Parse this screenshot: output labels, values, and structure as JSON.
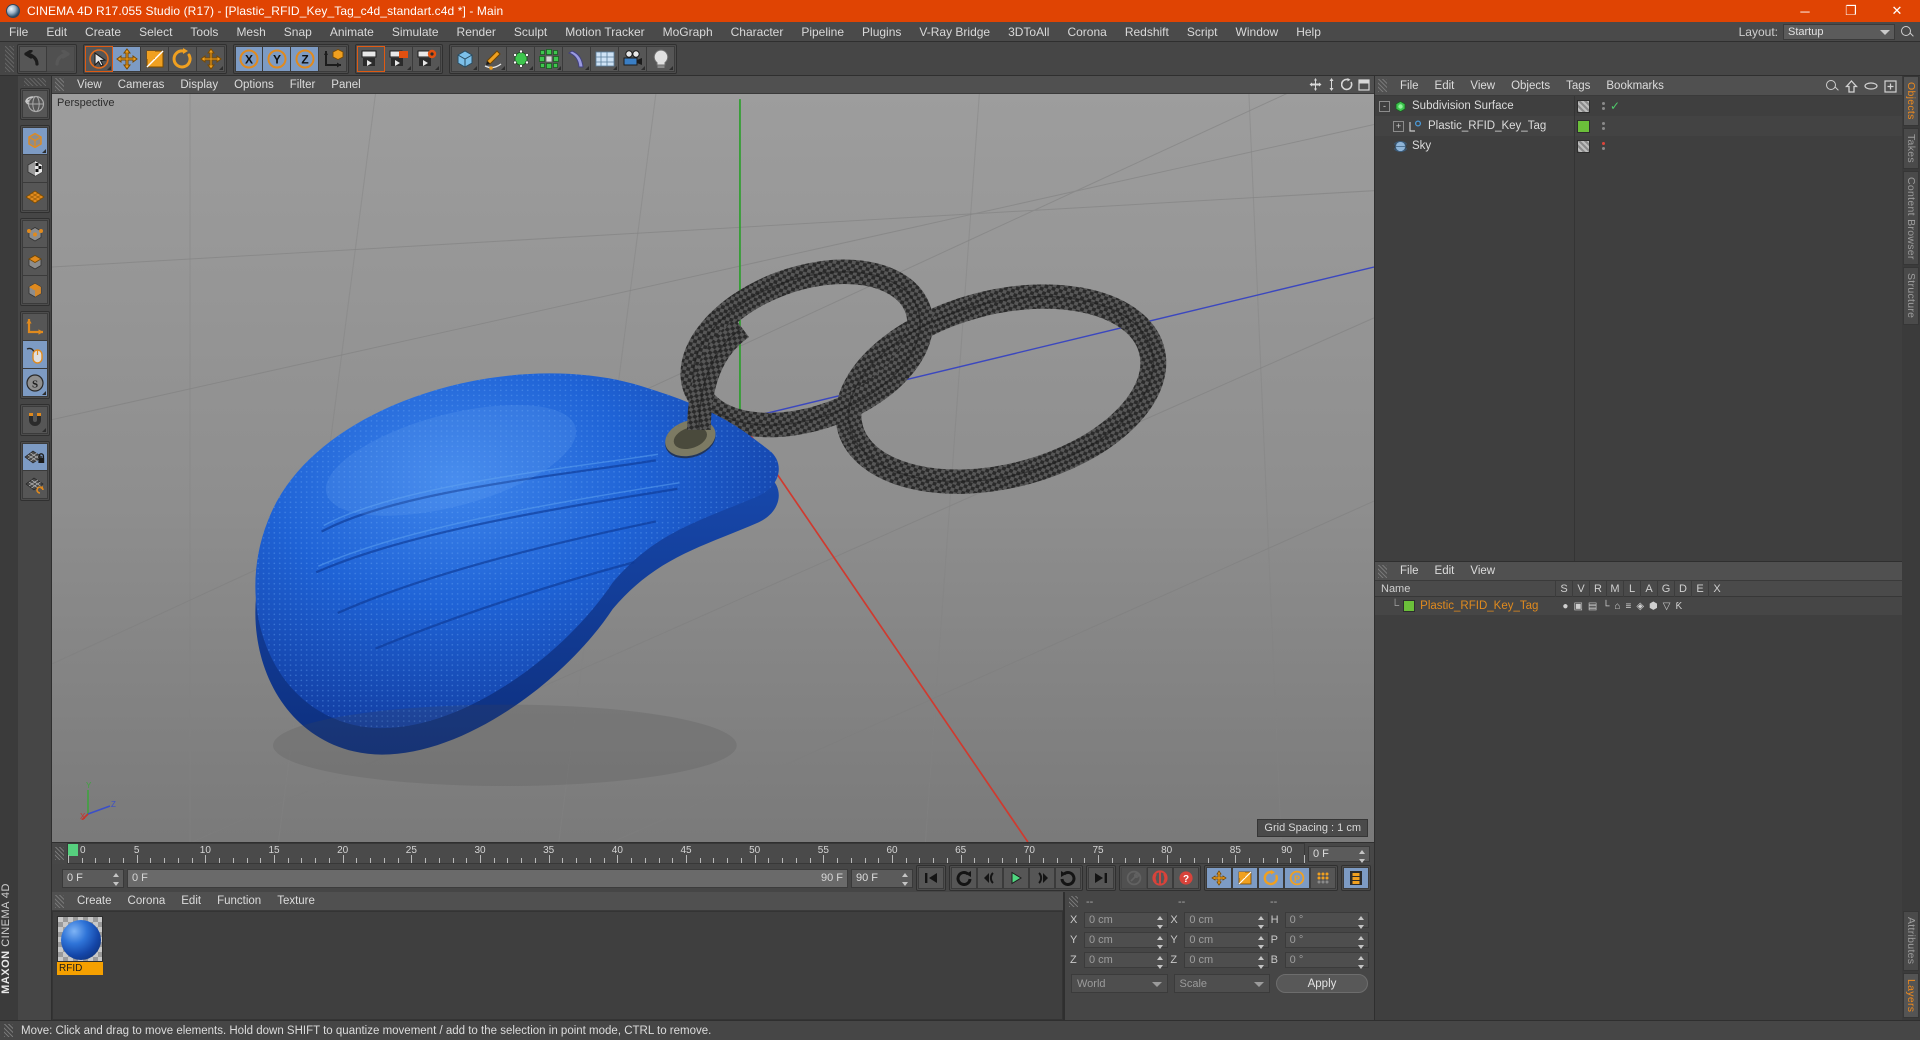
{
  "window": {
    "title": "CINEMA 4D R17.055 Studio (R17) - [Plastic_RFID_Key_Tag_c4d_standart.c4d *] - Main",
    "minimize": "─",
    "maximize": "❐",
    "close": "✕"
  },
  "menubar": {
    "items": [
      "File",
      "Edit",
      "Create",
      "Select",
      "Tools",
      "Mesh",
      "Snap",
      "Animate",
      "Simulate",
      "Render",
      "Sculpt",
      "Motion Tracker",
      "MoGraph",
      "Character",
      "Pipeline",
      "Plugins",
      "V-Ray Bridge",
      "3DToAll",
      "Corona",
      "Redshift",
      "Script",
      "Window",
      "Help"
    ],
    "layout_label": "Layout:",
    "layout_value": "Startup",
    "search_icon": "search-icon"
  },
  "toolbar": {
    "groups": [
      {
        "name": "undo-redo",
        "buttons": [
          {
            "icon": "undo-icon",
            "label": "Undo",
            "state": "normal"
          },
          {
            "icon": "redo-icon",
            "label": "Redo",
            "state": "disabled"
          }
        ]
      },
      {
        "name": "transform-tools",
        "buttons": [
          {
            "icon": "live-selection-icon",
            "label": "Live Selection",
            "state": "selected"
          },
          {
            "icon": "move-icon",
            "label": "Move",
            "state": "active"
          },
          {
            "icon": "scale-icon",
            "label": "Scale",
            "state": "normal"
          },
          {
            "icon": "rotate-icon",
            "label": "Rotate",
            "state": "normal"
          },
          {
            "icon": "move-alt-icon",
            "label": "Move",
            "state": "normal"
          }
        ]
      },
      {
        "name": "axis-locks",
        "buttons": [
          {
            "icon": "axis-x-icon",
            "label": "X",
            "state": "active"
          },
          {
            "icon": "axis-y-icon",
            "label": "Y",
            "state": "active"
          },
          {
            "icon": "axis-z-icon",
            "label": "Z",
            "state": "active"
          },
          {
            "icon": "world-object-axis-icon",
            "label": "World/Object",
            "state": "normal"
          }
        ]
      },
      {
        "name": "render-tools",
        "buttons": [
          {
            "icon": "render-view-icon",
            "label": "Render View",
            "state": "selected"
          },
          {
            "icon": "render-region-icon",
            "label": "Render to Picture Viewer",
            "state": "normal"
          },
          {
            "icon": "render-settings-icon",
            "label": "Edit Render Settings",
            "state": "normal"
          }
        ]
      },
      {
        "name": "create-tools",
        "buttons": [
          {
            "icon": "cube-primitive-icon",
            "label": "Add Cube Object",
            "state": "normal"
          },
          {
            "icon": "spline-pen-icon",
            "label": "Pen",
            "state": "normal"
          },
          {
            "icon": "nurbs-icon",
            "label": "Subdivision Surface",
            "state": "normal"
          },
          {
            "icon": "mograph-array-icon",
            "label": "Array",
            "state": "normal"
          },
          {
            "icon": "bend-deformer-icon",
            "label": "Bend",
            "state": "normal"
          },
          {
            "icon": "floor-environment-icon",
            "label": "Floor",
            "state": "normal"
          },
          {
            "icon": "camera-icon",
            "label": "Camera",
            "state": "normal"
          },
          {
            "icon": "light-icon",
            "label": "Light",
            "state": "normal"
          }
        ]
      }
    ]
  },
  "lefttools": {
    "groups": [
      {
        "buttons": [
          {
            "icon": "undo-view-icon",
            "label": "Undo View",
            "state": "normal"
          }
        ]
      },
      {
        "buttons": [
          {
            "icon": "model-mode-icon",
            "label": "Model Mode",
            "state": "active"
          },
          {
            "icon": "texture-mode-icon",
            "label": "Texture Mode",
            "state": "normal"
          },
          {
            "icon": "workplane-icon",
            "label": "Workplane",
            "state": "normal"
          }
        ]
      },
      {
        "buttons": [
          {
            "icon": "points-mode-icon",
            "label": "Points",
            "state": "normal"
          },
          {
            "icon": "edges-mode-icon",
            "label": "Edges",
            "state": "normal"
          },
          {
            "icon": "polygons-mode-icon",
            "label": "Polygons",
            "state": "normal"
          }
        ]
      },
      {
        "buttons": [
          {
            "icon": "enable-axis-icon",
            "label": "Enable Axis Modification",
            "state": "normal"
          },
          {
            "icon": "viewport-solo-icon",
            "label": "Viewport Solo",
            "state": "active"
          },
          {
            "icon": "soft-selection-icon",
            "label": "Soft Selection",
            "state": "active"
          }
        ]
      },
      {
        "buttons": [
          {
            "icon": "magnet-icon",
            "label": "Magnet",
            "state": "normal"
          }
        ]
      },
      {
        "buttons": [
          {
            "icon": "lock-workplane-icon",
            "label": "Lock Workplane",
            "state": "active"
          },
          {
            "icon": "planar-workplane-icon",
            "label": "Planar Workplane",
            "state": "normal"
          }
        ]
      }
    ]
  },
  "viewport": {
    "menu": [
      "View",
      "Cameras",
      "Display",
      "Options",
      "Filter",
      "Panel"
    ],
    "label": "Perspective",
    "grid_spacing": "Grid Spacing : 1 cm",
    "axis_labels": [
      "Y",
      "Z",
      "X"
    ],
    "icons": [
      "pan-icon",
      "zoom-icon",
      "rotate-view-icon",
      "maximize-view-icon"
    ],
    "colors": {
      "bg_top": "#9a9a9a",
      "bg_bottom": "#7d7d7d",
      "object_blue": "#1f5fd0",
      "cord_dark": "#2b2b2b",
      "axis_x": "#c8342b",
      "axis_y": "#3fa33f",
      "axis_z": "#3a4fc8"
    }
  },
  "timeline": {
    "ticks": [
      0,
      5,
      10,
      15,
      20,
      25,
      30,
      35,
      40,
      45,
      50,
      55,
      60,
      65,
      70,
      75,
      80,
      85,
      90
    ],
    "current_frame_box": "0 F",
    "start_field": "0 F",
    "range_start": "0 F",
    "range_end": "90 F",
    "end_field": "90 F",
    "transport": [
      {
        "icon": "goto-start-icon",
        "label": "Go to Start",
        "state": "normal"
      },
      {
        "icon": "keyframe-prev-icon",
        "label": "Go to Previous Key",
        "state": "normal"
      },
      {
        "icon": "step-back-icon",
        "label": "Go to Previous Frame",
        "state": "normal"
      },
      {
        "icon": "play-icon",
        "label": "Play Forwards",
        "state": "normal"
      },
      {
        "icon": "step-forward-icon",
        "label": "Go to Next Frame",
        "state": "normal"
      },
      {
        "icon": "keyframe-next-icon",
        "label": "Go to Next Key",
        "state": "normal"
      },
      {
        "icon": "goto-end-icon",
        "label": "Go to End",
        "state": "normal"
      }
    ],
    "record": [
      {
        "icon": "autokey-icon",
        "label": "Autokeying",
        "state": "disabled"
      },
      {
        "icon": "record-icon",
        "label": "Record Active Objects",
        "state": "normal"
      },
      {
        "icon": "keyframe-select-icon",
        "label": "Keyframe Selection",
        "state": "normal"
      }
    ],
    "param": [
      {
        "icon": "key-position-icon",
        "label": "Position",
        "state": "active"
      },
      {
        "icon": "key-scale-icon",
        "label": "Scale",
        "state": "active"
      },
      {
        "icon": "key-rotation-icon",
        "label": "Rotation",
        "state": "active"
      },
      {
        "icon": "key-param-icon",
        "label": "Parameter",
        "state": "active"
      },
      {
        "icon": "key-pla-icon",
        "label": "Point Level Animation",
        "state": "normal"
      }
    ],
    "extra": [
      {
        "icon": "timeline-strip-icon",
        "label": "Animation Layers",
        "state": "active"
      }
    ]
  },
  "material_manager": {
    "menu": [
      "Create",
      "Corona",
      "Edit",
      "Function",
      "Texture"
    ],
    "materials": [
      {
        "name": "RFID",
        "color": "#1f5fd0"
      }
    ]
  },
  "coordinates": {
    "headers": [
      "--",
      "--",
      "--"
    ],
    "rows": [
      {
        "lb1": "X",
        "v1": "0 cm",
        "lb2": "X",
        "v2": "0 cm",
        "lb3": "H",
        "v3": "0 °"
      },
      {
        "lb1": "Y",
        "v1": "0 cm",
        "lb2": "Y",
        "v2": "0 cm",
        "lb3": "P",
        "v3": "0 °"
      },
      {
        "lb1": "Z",
        "v1": "0 cm",
        "lb2": "Z",
        "v2": "0 cm",
        "lb3": "B",
        "v3": "0 °"
      }
    ],
    "system": "World",
    "mode": "Scale",
    "apply": "Apply"
  },
  "object_manager": {
    "menu": [
      "File",
      "Edit",
      "View",
      "Objects",
      "Tags",
      "Bookmarks"
    ],
    "icons": [
      "search-icon",
      "up-arrow-icon",
      "ellipse-icon",
      "fit-icon"
    ],
    "rows": [
      {
        "name": "Subdivision Surface",
        "indent": 0,
        "icon": "subdivision-surface-icon",
        "expander": "-",
        "tag1": "hatch",
        "check": "✓",
        "dot": ""
      },
      {
        "name": "Plastic_RFID_Key_Tag",
        "indent": 1,
        "icon": "polygon-object-icon",
        "expander": "+",
        "tag1": "green",
        "check": "",
        "dot": ""
      },
      {
        "name": "Sky",
        "indent": 0,
        "icon": "sky-object-icon",
        "expander": "",
        "tag1": "hatch",
        "check": "",
        "dot": "red"
      }
    ]
  },
  "object_materials": {
    "menu": [
      "File",
      "Edit",
      "View"
    ],
    "columns": [
      "Name",
      "S",
      "V",
      "R",
      "M",
      "L",
      "A",
      "G",
      "D",
      "E",
      "X"
    ],
    "rows": [
      {
        "name": "Plastic_RFID_Key_Tag",
        "color": "#6bbf3a"
      }
    ]
  },
  "right_tabs": [
    {
      "label": "Objects",
      "active": true
    },
    {
      "label": "Takes",
      "active": false
    },
    {
      "label": "Content Browser",
      "active": false
    },
    {
      "label": "Structure",
      "active": false
    }
  ],
  "right_tabs_lower": [
    {
      "label": "Attributes",
      "active": false
    },
    {
      "label": "Layers",
      "active": true
    }
  ],
  "brand": {
    "maxon": "MAXON",
    "c4d": "CINEMA 4D"
  },
  "statusbar": {
    "text": "Move: Click and drag to move elements. Hold down SHIFT to quantize movement / add to the selection in point mode, CTRL to remove."
  }
}
